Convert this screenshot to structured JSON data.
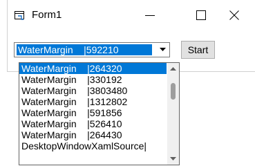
{
  "window": {
    "title": "Form1"
  },
  "combo": {
    "value": "WaterMargin    |592210"
  },
  "start_button": {
    "label": "Start"
  },
  "dropdown": {
    "items": [
      "WaterMargin    |264320",
      "WaterMargin    |330192",
      "WaterMargin    |3803480",
      "WaterMargin    |1312802",
      "WaterMargin    |591856",
      "WaterMargin    |526410",
      "WaterMargin    |264430",
      "DesktopWindowXamlSource|"
    ],
    "selected_index": 0
  },
  "colors": {
    "selection": "#0078d7",
    "button_face": "#e1e1e1"
  }
}
